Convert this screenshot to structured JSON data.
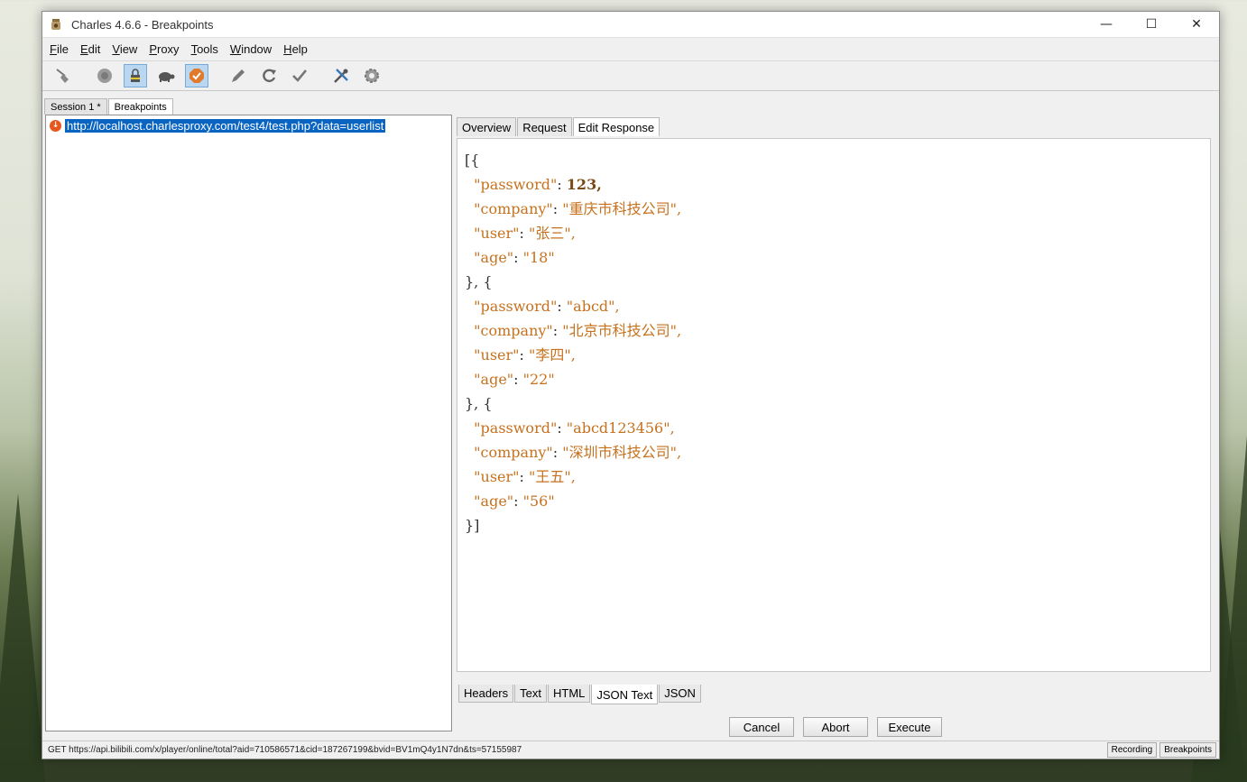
{
  "window": {
    "title": "Charles 4.6.6 - Breakpoints",
    "minimize": "—",
    "maximize": "☐",
    "close": "✕"
  },
  "menu": [
    "File",
    "Edit",
    "View",
    "Proxy",
    "Tools",
    "Window",
    "Help"
  ],
  "toolbar": {
    "icons": [
      "broom-icon",
      "record-icon",
      "throttle-lock-icon",
      "turtle-icon",
      "breakpoints-icon",
      "pen-icon",
      "refresh-icon",
      "check-icon",
      "tools-icon",
      "gear-icon"
    ],
    "active": [
      "throttle-lock-icon",
      "breakpoints-icon"
    ]
  },
  "session_tabs": [
    "Session 1 *",
    "Breakpoints"
  ],
  "breakpoints": {
    "url": "http://localhost.charlesproxy.com/test4/test.php?data=userlist"
  },
  "request_tabs": [
    "Overview",
    "Request",
    "Edit Response"
  ],
  "response_json": [
    {
      "password": "123",
      "company": "重庆市科技公司",
      "user": "张三",
      "age": "18"
    },
    {
      "password": "abcd",
      "company": "北京市科技公司",
      "user": "李四",
      "age": "22"
    },
    {
      "password": "abcd123456",
      "company": "深圳市科技公司",
      "user": "王五",
      "age": "56"
    }
  ],
  "json_text": {
    "open": "[{",
    "sep": "}, {",
    "close": "}]",
    "keys": {
      "password": "\"password\"",
      "company": "\"company\"",
      "user": "\"user\"",
      "age": "\"age\""
    },
    "colon": ": ",
    "entries": [
      {
        "password": "123,",
        "company": "\"重庆市科技公司\",",
        "user": "\"张三\",",
        "age": "\"18\""
      },
      {
        "password": "\"abcd\",",
        "company": "\"北京市科技公司\",",
        "user": "\"李四\",",
        "age": "\"22\""
      },
      {
        "password": "\"abcd123456\",",
        "company": "\"深圳市科技公司\",",
        "user": "\"王五\",",
        "age": "\"56\""
      }
    ]
  },
  "view_tabs": [
    "Headers",
    "Text",
    "HTML",
    "JSON Text",
    "JSON"
  ],
  "buttons": {
    "cancel": "Cancel",
    "abort": "Abort",
    "execute": "Execute"
  },
  "status": {
    "text": "GET https://api.bilibili.com/x/player/online/total?aid=710586571&cid=187267199&bvid=BV1mQ4y1N7dn&ts=57155987",
    "recording": "Recording",
    "breakpoints": "Breakpoints"
  },
  "colors": {
    "selection": "#0a64c2",
    "json_string": "#c6711e",
    "json_number": "#7a4a14",
    "breakpoint_icon": "#e8571f"
  }
}
